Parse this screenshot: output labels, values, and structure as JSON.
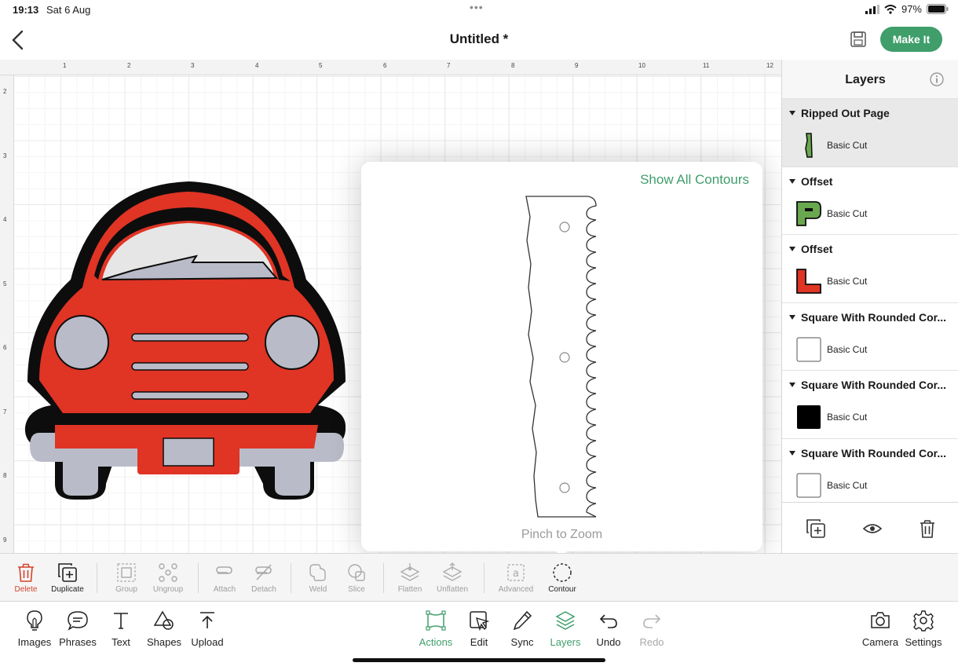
{
  "status_bar": {
    "time": "19:13",
    "date": "Sat 6 Aug",
    "battery": "97%",
    "dots": "•••"
  },
  "header": {
    "title": "Untitled *",
    "make_it": "Make It"
  },
  "ruler": {
    "top": [
      "1",
      "2",
      "3",
      "4",
      "5",
      "6",
      "7",
      "8",
      "9",
      "10",
      "11",
      "12"
    ],
    "left": [
      "2",
      "3",
      "4",
      "5",
      "6",
      "7",
      "8",
      "9"
    ]
  },
  "contour_popover": {
    "show_all": "Show All Contours",
    "hint": "Pinch to Zoom"
  },
  "layers": {
    "title": "Layers",
    "groups": [
      {
        "name": "Ripped Out Page",
        "op": "Basic Cut",
        "thumb": "green-strip",
        "selected": true
      },
      {
        "name": "Offset",
        "op": "Basic Cut",
        "thumb": "green-shape"
      },
      {
        "name": "Offset",
        "op": "Basic Cut",
        "thumb": "red-shape"
      },
      {
        "name": "Square With Rounded Cor...",
        "op": "Basic Cut",
        "thumb": "white-square"
      },
      {
        "name": "Square With Rounded Cor...",
        "op": "Basic Cut",
        "thumb": "black-square"
      },
      {
        "name": "Square With Rounded Cor...",
        "op": "Basic Cut",
        "thumb": "white-square"
      }
    ]
  },
  "toolbar": {
    "delete": "Delete",
    "duplicate": "Duplicate",
    "group": "Group",
    "ungroup": "Ungroup",
    "attach": "Attach",
    "detach": "Detach",
    "weld": "Weld",
    "slice": "Slice",
    "flatten": "Flatten",
    "unflatten": "Unflatten",
    "advanced": "Advanced",
    "contour": "Contour"
  },
  "nav": {
    "images": "Images",
    "phrases": "Phrases",
    "text": "Text",
    "shapes": "Shapes",
    "upload": "Upload",
    "actions": "Actions",
    "edit": "Edit",
    "sync": "Sync",
    "layers": "Layers",
    "undo": "Undo",
    "redo": "Redo",
    "camera": "Camera",
    "settings": "Settings"
  },
  "colors": {
    "accent_green": "#3f9e6a",
    "delete_red": "#d4432b",
    "car_red": "#e03424",
    "car_grey": "#b9bcc8"
  }
}
